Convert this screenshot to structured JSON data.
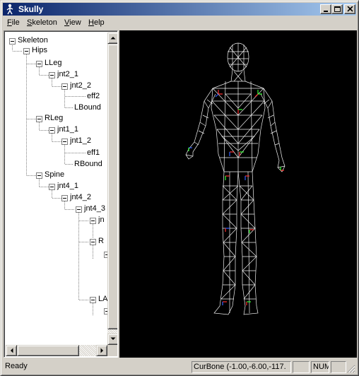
{
  "window": {
    "title": "Skully",
    "controls": {
      "minimize": "minimize",
      "maximize": "maximize",
      "close": "close"
    }
  },
  "menu": {
    "items": [
      {
        "accel": "F",
        "rest": "ile"
      },
      {
        "accel": "S",
        "rest": "keleton"
      },
      {
        "accel": "V",
        "rest": "iew"
      },
      {
        "accel": "H",
        "rest": "elp"
      }
    ]
  },
  "tree": {
    "nodes": [
      {
        "label": "Skeleton"
      },
      {
        "label": "Hips"
      },
      {
        "label": "LLeg"
      },
      {
        "label": "jnt2_1"
      },
      {
        "label": "jnt2_2"
      },
      {
        "label": "eff2"
      },
      {
        "label": "LBound"
      },
      {
        "label": "RLeg"
      },
      {
        "label": "jnt1_1"
      },
      {
        "label": "jnt1_2"
      },
      {
        "label": "eff1"
      },
      {
        "label": "RBound"
      },
      {
        "label": "Spine"
      },
      {
        "label": "jnt4_1"
      },
      {
        "label": "jnt4_2"
      },
      {
        "label": "jnt4_3"
      },
      {
        "label": "jn"
      },
      {
        "label": "R"
      },
      {
        "label": "LA"
      }
    ]
  },
  "status": {
    "ready": "Ready",
    "curbone": "CurBone (-1.00,-6.00,-117.",
    "num": "NUM"
  },
  "colors": {
    "titlebar_start": "#0a246a",
    "titlebar_end": "#a6caf0",
    "viewport_bg": "#000000",
    "wireframe": "#ffffff"
  }
}
